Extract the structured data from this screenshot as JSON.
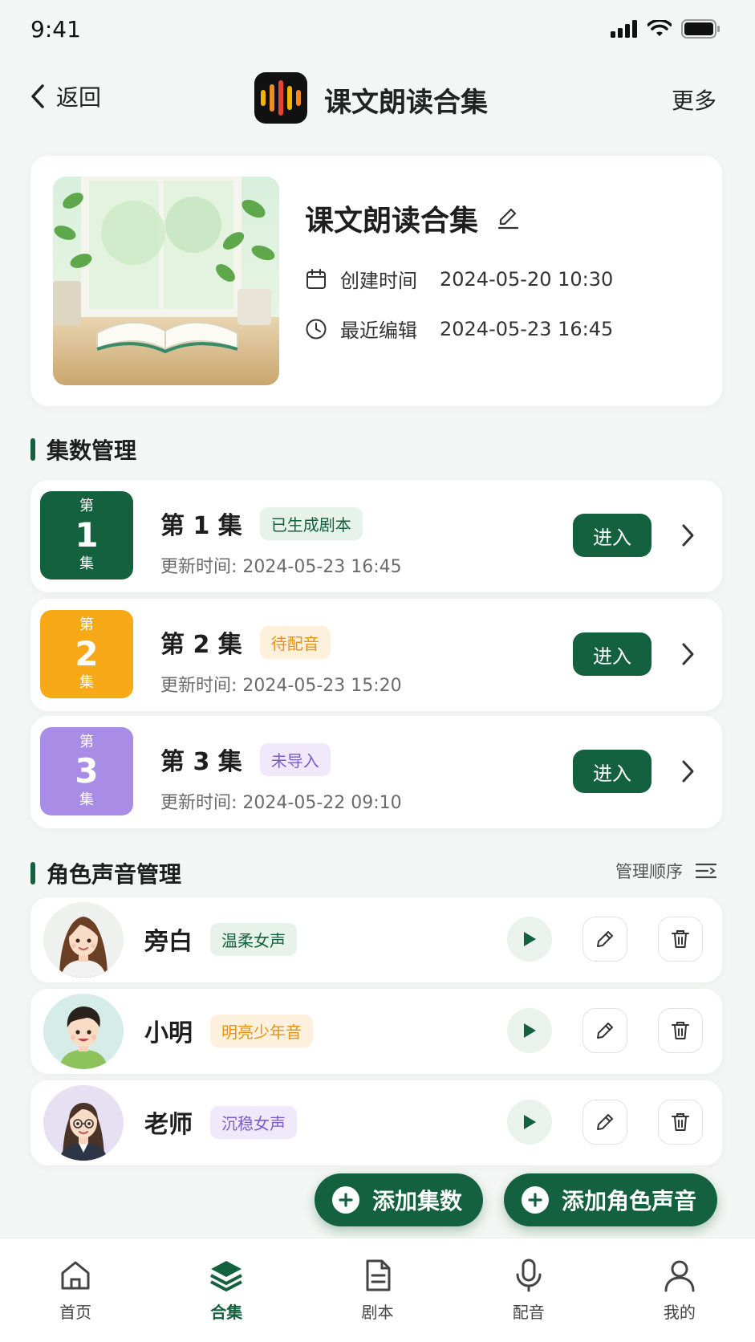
{
  "status_bar": {
    "time": "9:41"
  },
  "header": {
    "back_label": "返回",
    "title": "课文朗读合集",
    "more_label": "更多"
  },
  "collection": {
    "title": "课文朗读合集",
    "created_label": "创建时间",
    "created_value": "2024-05-20 10:30",
    "edited_label": "最近编辑",
    "edited_value": "2024-05-23 16:45"
  },
  "episodes_section": {
    "title": "集数管理",
    "items": [
      {
        "prefix": "第",
        "num": "1",
        "suffix": "集",
        "title": "第 1 集",
        "tag": "已生成剧本",
        "time": "更新时间:  2024-05-23 16:45",
        "enter_label": "进入",
        "badge_color": "#14613f",
        "tag_color": "#14613f",
        "tag_bg": "#e6f2ea"
      },
      {
        "prefix": "第",
        "num": "2",
        "suffix": "集",
        "title": "第 2 集",
        "tag": "待配音",
        "time": "更新时间:  2024-05-23 15:20",
        "enter_label": "进入",
        "badge_color": "#f8a918",
        "tag_color": "#e8920f",
        "tag_bg": "#fdf1de"
      },
      {
        "prefix": "第",
        "num": "3",
        "suffix": "集",
        "title": "第 3 集",
        "tag": "未导入",
        "time": "更新时间:  2024-05-22 09:10",
        "enter_label": "进入",
        "badge_color": "#a98ce6",
        "tag_color": "#7a5bd0",
        "tag_bg": "#efe9fb"
      }
    ]
  },
  "roles_section": {
    "title": "角色声音管理",
    "manage_order_label": "管理顺序",
    "items": [
      {
        "name": "旁白",
        "voice": "温柔女声",
        "tag_color": "#14613f",
        "tag_bg": "#e6f2ea"
      },
      {
        "name": "小明",
        "voice": "明亮少年音",
        "tag_color": "#e8920f",
        "tag_bg": "#fdf1de"
      },
      {
        "name": "老师",
        "voice": "沉稳女声",
        "tag_color": "#7a5bd0",
        "tag_bg": "#efe9fb"
      }
    ]
  },
  "fab": {
    "add_episode": "添加集数",
    "add_role": "添加角色声音"
  },
  "tabbar": {
    "items": [
      {
        "label": "首页",
        "icon": "home-icon"
      },
      {
        "label": "合集",
        "icon": "layers-icon",
        "active": true
      },
      {
        "label": "剧本",
        "icon": "document-icon"
      },
      {
        "label": "配音",
        "icon": "microphone-icon"
      },
      {
        "label": "我的",
        "icon": "user-icon"
      }
    ]
  },
  "colors": {
    "primary": "#14613f",
    "background": "#f3f6f4"
  }
}
